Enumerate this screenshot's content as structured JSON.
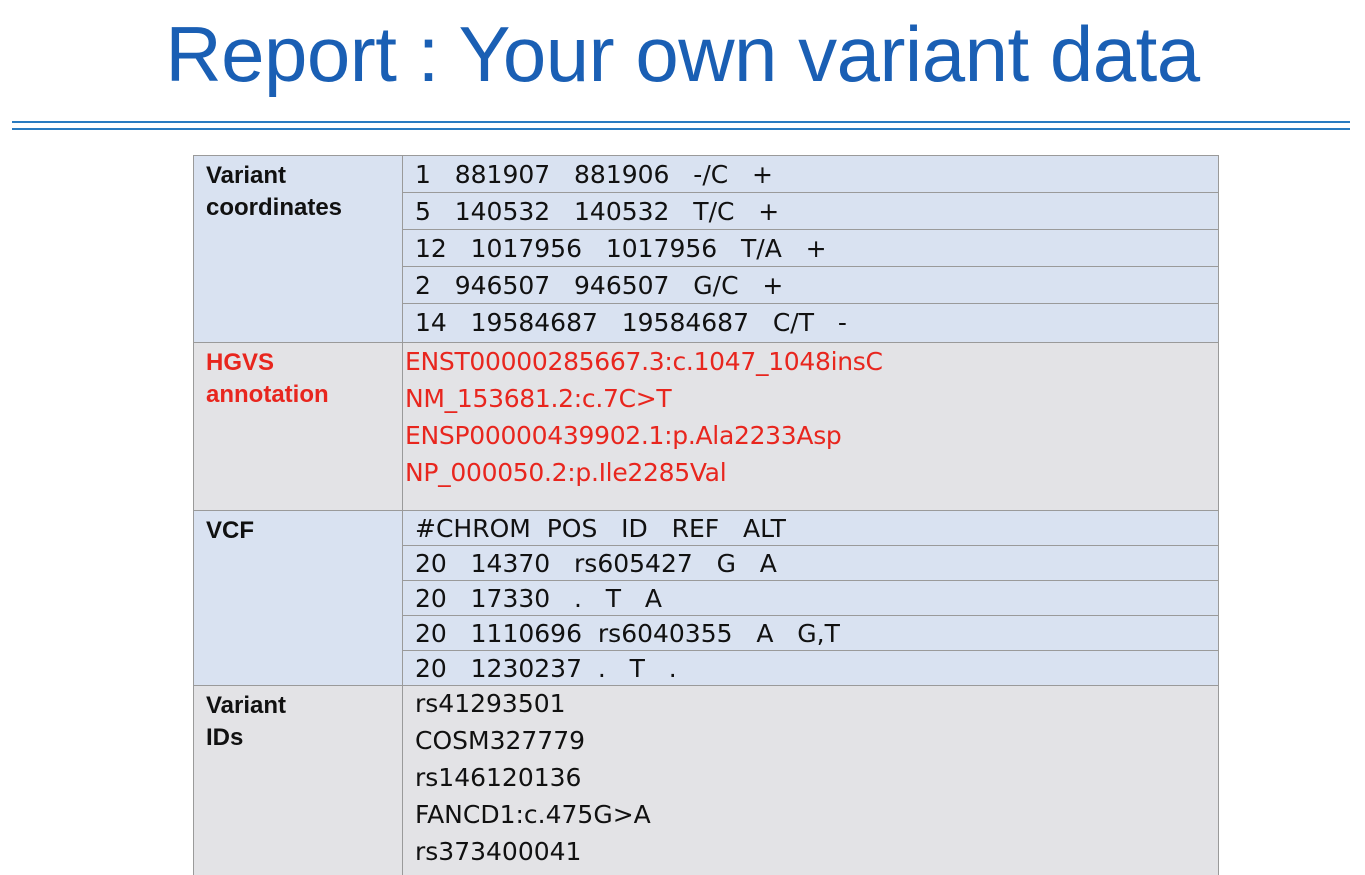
{
  "title": "Report : Your own variant data",
  "sections": {
    "coordinates": {
      "label": "Variant\ncoordinates",
      "rows": [
        "1   881907   881906   -/C   +",
        "5   140532   140532   T/C   +",
        "12   1017956   1017956   T/A   +",
        "2   946507   946507   G/C   +",
        "14   19584687   19584687   C/T   -"
      ]
    },
    "hgvs": {
      "label": "HGVS\nannotation",
      "rows": [
        "ENST00000285667.3:c.1047_1048insC",
        "NM_153681.2:c.7C>T",
        "ENSP00000439902.1:p.Ala2233Asp",
        "NP_000050.2:p.Ile2285Val"
      ]
    },
    "vcf": {
      "label": "VCF",
      "rows": [
        "#CHROM  POS   ID   REF   ALT",
        "20   14370   rs605427   G   A",
        "20   17330   .   T   A",
        "20   1110696  rs6040355   A   G,T",
        "20   1230237  .   T   ."
      ]
    },
    "ids": {
      "label": "Variant\nIDs",
      "rows": [
        "rs41293501",
        "COSM327779",
        "rs146120136",
        "FANCD1:c.475G>A",
        "rs373400041"
      ]
    }
  },
  "colors": {
    "title": "#1a5fb4",
    "rule": "#2a7bc0",
    "row_blue": "#d9e2f1",
    "row_grey": "#e3e3e6",
    "hgvs_red": "#e8261e"
  }
}
